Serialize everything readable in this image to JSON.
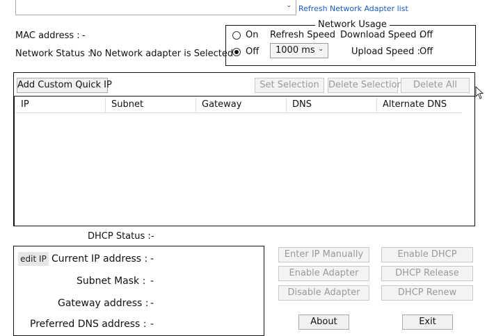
{
  "adapter_combo": {
    "value": ""
  },
  "refresh_link": "Refresh Network Adapter list",
  "mac": {
    "label": "MAC address :",
    "value": "-"
  },
  "network_status": {
    "label": "Network Status :",
    "value": "No Network adapter is Selected"
  },
  "usage": {
    "title": "Network Usage",
    "on_label": "On",
    "off_label": "Off",
    "selected": "Off",
    "refresh_speed_label": "Refresh Speed",
    "refresh_speed_value": "1000 ms",
    "download_label": "Download Speed :",
    "download_value": "Off",
    "upload_label": "Upload Speed :",
    "upload_value": "Off"
  },
  "toolbar": {
    "add_custom": "Add Custom Quick IP",
    "set_selection": "Set Selection",
    "delete_selection": "Delete Selection",
    "delete_all": "Delete All"
  },
  "table": {
    "columns": [
      "IP",
      "Subnet",
      "Gateway",
      "DNS",
      "Alternate DNS"
    ],
    "rows": []
  },
  "dhcp_status": {
    "label": "DHCP Status :",
    "value": "-"
  },
  "ip_info": {
    "edit_label": "edit IP",
    "current_ip_label": "Current IP address :",
    "current_ip_value": "-",
    "subnet_label": "Subnet Mask :",
    "subnet_value": "-",
    "gateway_label": "Gateway address :",
    "gateway_value": "-",
    "dns_label": "Preferred DNS address :",
    "dns_value": "-"
  },
  "actions": {
    "enter_ip": "Enter IP Manually",
    "enable_dhcp": "Enable DHCP",
    "enable_adapter": "Enable Adapter",
    "dhcp_release": "DHCP Release",
    "disable_adapter": "Disable Adapter",
    "dhcp_renew": "DHCP Renew",
    "about": "About",
    "exit": "Exit"
  }
}
